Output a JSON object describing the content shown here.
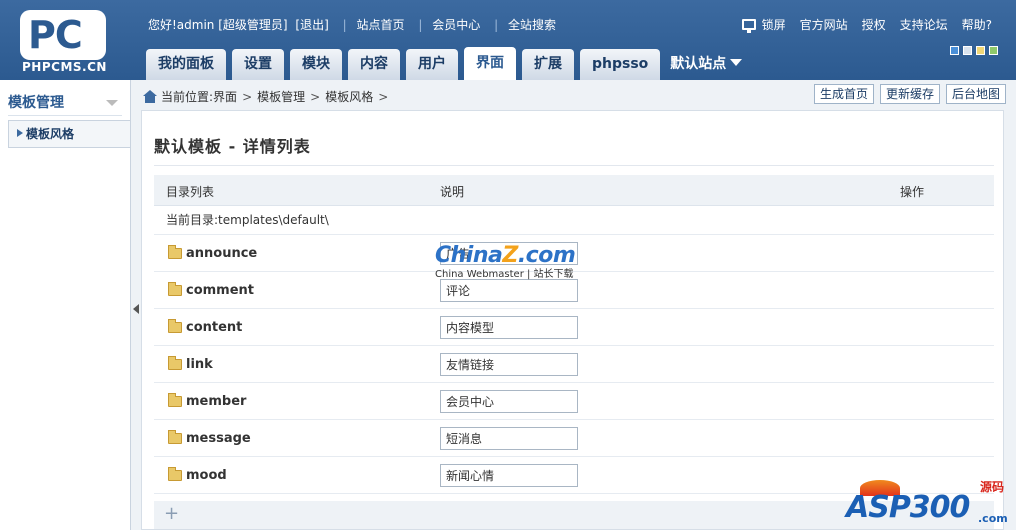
{
  "logo": {
    "letters": "PC",
    "text": "PHPCMS.CN"
  },
  "topbar": {
    "greeting": "您好!admin [超级管理员]",
    "logout": "[退出]",
    "links": [
      "站点首页",
      "会员中心",
      "全站搜索"
    ]
  },
  "topright": {
    "lock": "锁屏",
    "links": [
      "官方网站",
      "授权",
      "支持论坛",
      "帮助?"
    ]
  },
  "skins": [
    "#4a90d9",
    "#d9e3ee",
    "#f0d777",
    "#8fc96b"
  ],
  "nav": {
    "tabs": [
      "我的面板",
      "设置",
      "模块",
      "内容",
      "用户",
      "界面",
      "扩展",
      "phpsso"
    ],
    "active_index": 5,
    "site_selector": "默认站点"
  },
  "left": {
    "title": "模板管理",
    "item": "模板风格"
  },
  "breadcrumb": {
    "prefix": "当前位置:",
    "items": [
      "界面",
      "模板管理",
      "模板风格"
    ],
    "trailing": ">"
  },
  "actions": [
    "生成首页",
    "更新缓存",
    "后台地图"
  ],
  "heading": "默认模板 - 详情列表",
  "table": {
    "headers": {
      "dir": "目录列表",
      "desc": "说明",
      "ops": "操作"
    },
    "current_dir": "当前目录:templates\\default\\",
    "rows": [
      {
        "name": "announce",
        "desc": "广告"
      },
      {
        "name": "comment",
        "desc": "评论"
      },
      {
        "name": "content",
        "desc": "内容模型"
      },
      {
        "name": "link",
        "desc": "友情链接"
      },
      {
        "name": "member",
        "desc": "会员中心"
      },
      {
        "name": "message",
        "desc": "短消息"
      },
      {
        "name": "mood",
        "desc": "新闻心情"
      }
    ]
  },
  "footer": {
    "plus": "+"
  },
  "watermarks": {
    "china_a": "China",
    "china_z": "Z",
    "china_b": ".com",
    "china_sub": "China Webmaster | 站长下载",
    "asp": "ASP300",
    "asp_yuan": "源码",
    "asp_com": ".com"
  }
}
